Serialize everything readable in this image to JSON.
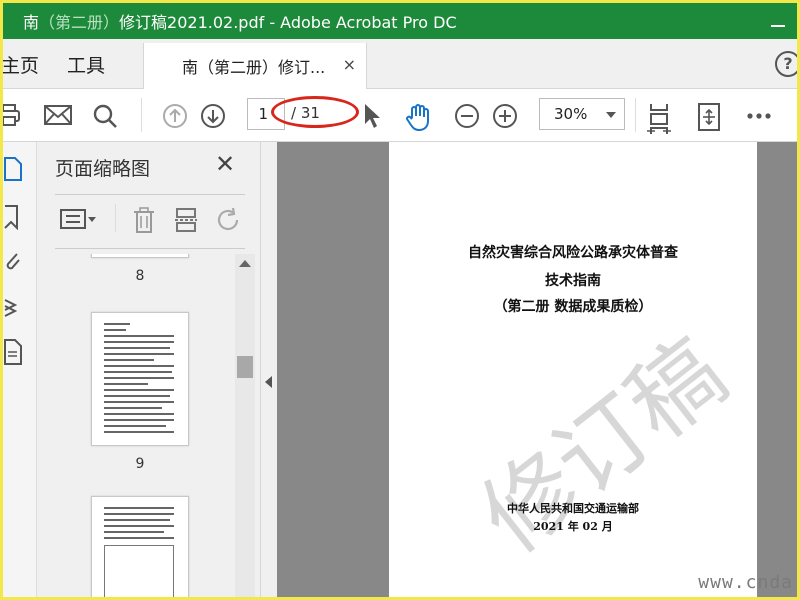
{
  "window": {
    "title_prefix": "南",
    "title_faded": "（第二册）",
    "title_rest": "修订稿2021.02.pdf - Adobe Acrobat Pro DC"
  },
  "nav": {
    "home": "主页",
    "tools": "工具"
  },
  "tab": {
    "label": "南（第二册）修订...",
    "close": "×"
  },
  "help": "?",
  "toolbar": {
    "page_current": "1",
    "page_total": "/ 31",
    "zoom": "30%"
  },
  "panel": {
    "title": "页面缩略图",
    "close": "✕",
    "thumbnails": [
      {
        "label": "8"
      },
      {
        "label": "9"
      }
    ]
  },
  "document": {
    "title_lines": [
      "自然灾害综合风险公路承灾体普查",
      "技术指南",
      "（第二册  数据成果质检）"
    ],
    "publisher": "中华人民共和国交通运输部",
    "date": "2021 年 02 月",
    "watermark": "修订稿"
  },
  "site_watermark": "www.cnda",
  "colors": {
    "titlebar": "#1c8a3a",
    "accent_blue": "#1a73c8",
    "annotation_red": "#d9261c",
    "border_yellow": "#f3e84a"
  },
  "icons": {
    "print": "print-icon",
    "mail": "mail-icon",
    "search": "search-icon",
    "prev_page": "arrow-up-circle-icon",
    "next_page": "arrow-down-circle-icon",
    "select": "cursor-arrow-icon",
    "hand": "hand-icon",
    "zoom_out": "zoom-out-icon",
    "zoom_in": "zoom-in-icon",
    "fit_page": "fit-page-icon",
    "rotate_view": "rotate-view-icon",
    "more": "more-icon"
  }
}
